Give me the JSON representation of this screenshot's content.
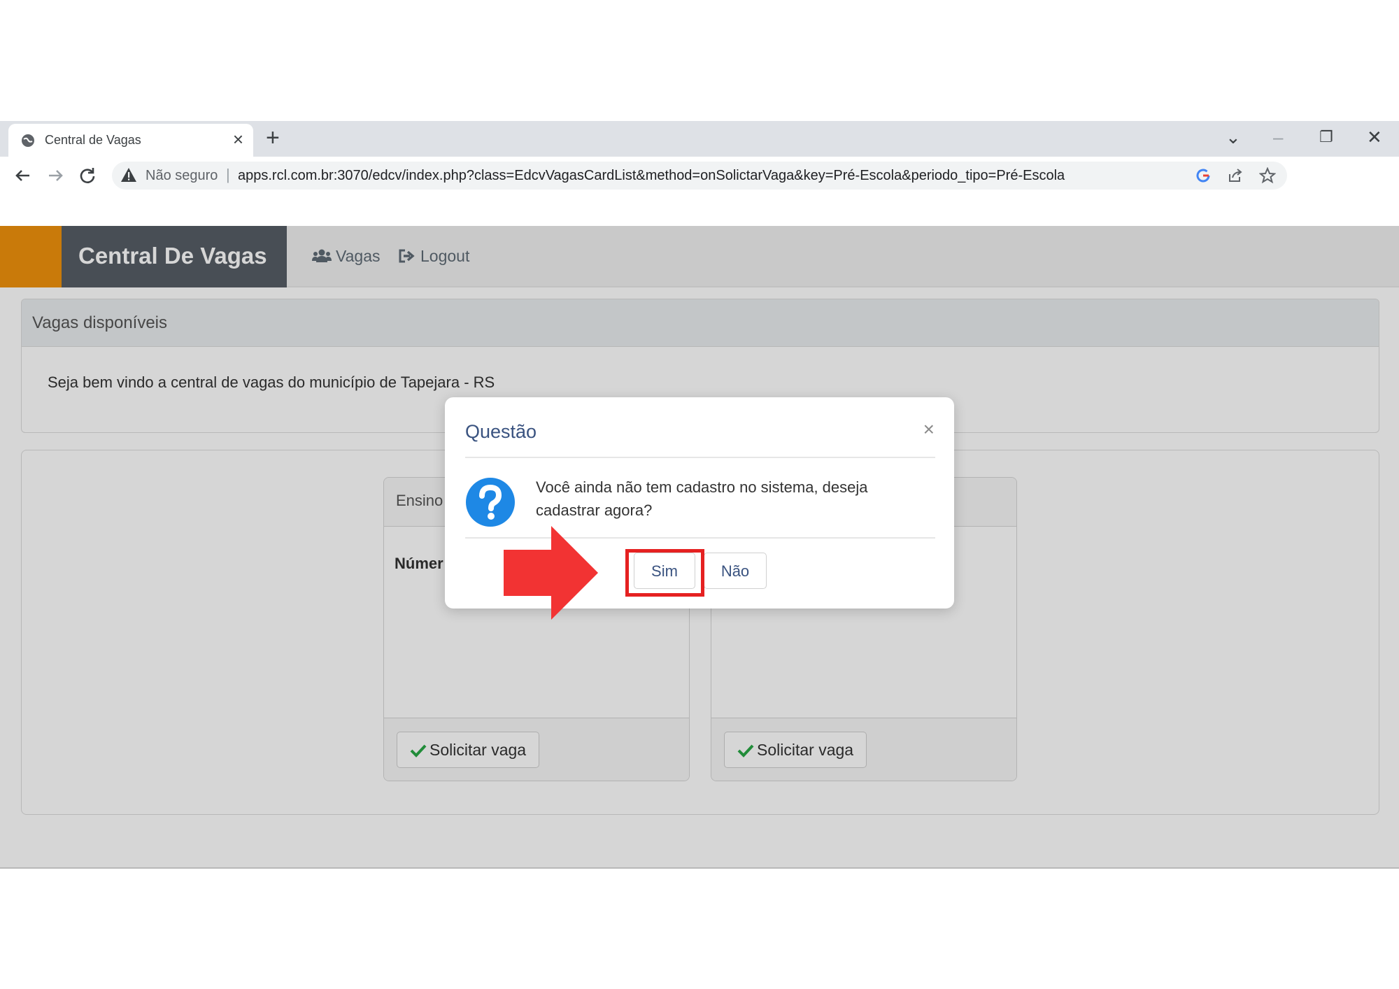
{
  "browser": {
    "tab_title": "Central de Vagas",
    "tab_close": "×",
    "new_tab": "+",
    "insecure_label": "Não seguro",
    "url_separator": "|",
    "url": "apps.rcl.com.br:3070/edcv/index.php?class=EdcvVagasCardList&method=onSolictarVaga&key=Pré-Escola&periodo_tipo=Pré-Escola",
    "window_controls": {
      "chevron": "⌄",
      "minimize": "–",
      "restore": "❐",
      "close": "✕"
    }
  },
  "app": {
    "brand": "Central De Vagas",
    "accent_color": "#f0920c",
    "nav": [
      {
        "label": "Vagas",
        "icon": "users-icon"
      },
      {
        "label": "Logout",
        "icon": "sign-out-icon"
      }
    ]
  },
  "welcome_panel": {
    "title": "Vagas disponíveis",
    "message": "Seja bem vindo a central de vagas do município de Tapejara - RS"
  },
  "cards": [
    {
      "header": "Ensino",
      "body_label": "Númer",
      "button_label": "Solicitar vaga"
    },
    {
      "header": "",
      "body_label": "",
      "button_label": "Solicitar vaga"
    }
  ],
  "dialog": {
    "title": "Questão",
    "close": "×",
    "message": "Você ainda não tem cadastro no sistema, deseja cadastrar agora?",
    "confirm_label": "Sim",
    "cancel_label": "Não",
    "icon": "question-circle-icon",
    "icon_color": "#1e88e5"
  },
  "annotation": {
    "highlight_color": "#e52121",
    "arrow_color": "#f23333"
  }
}
